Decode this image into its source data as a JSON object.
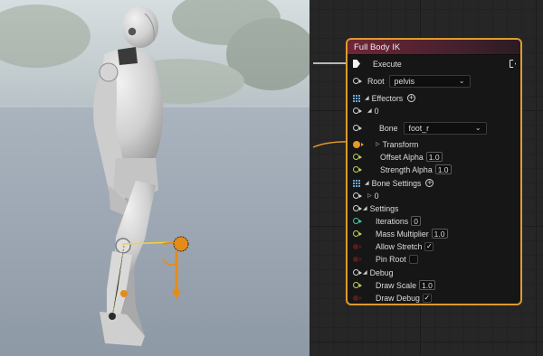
{
  "node": {
    "title": "Full Body IK",
    "execute_label": "Execute",
    "root": {
      "label": "Root",
      "value": "pelvis"
    },
    "effectors": {
      "label": "Effectors",
      "index": "0",
      "bone": {
        "label": "Bone",
        "value": "foot_r"
      },
      "transform_label": "Transform",
      "offset_alpha": {
        "label": "Offset Alpha",
        "value": "1.0"
      },
      "strength_alpha": {
        "label": "Strength Alpha",
        "value": "1.0"
      }
    },
    "bone_settings": {
      "label": "Bone Settings",
      "index": "0"
    },
    "settings": {
      "label": "Settings",
      "iterations": {
        "label": "Iterations",
        "value": "0"
      },
      "mass_multiplier": {
        "label": "Mass Multiplier",
        "value": "1.0"
      },
      "allow_stretch": {
        "label": "Allow Stretch",
        "checked": true
      },
      "pin_root": {
        "label": "Pin Root",
        "checked": false
      }
    },
    "debug": {
      "label": "Debug",
      "draw_scale": {
        "label": "Draw Scale",
        "value": "1.0"
      },
      "draw_debug": {
        "label": "Draw Debug",
        "checked": true
      }
    }
  },
  "icons": {
    "check": "✓",
    "dropdown": "chevron-down-icon",
    "add": "plus-circle-icon"
  },
  "colors": {
    "node_border": "#e09a2e",
    "header": "#6f2637",
    "transform_pin": "#e39a2a",
    "float_pin": "#b8d35a",
    "int_pin": "#41c9a8"
  }
}
